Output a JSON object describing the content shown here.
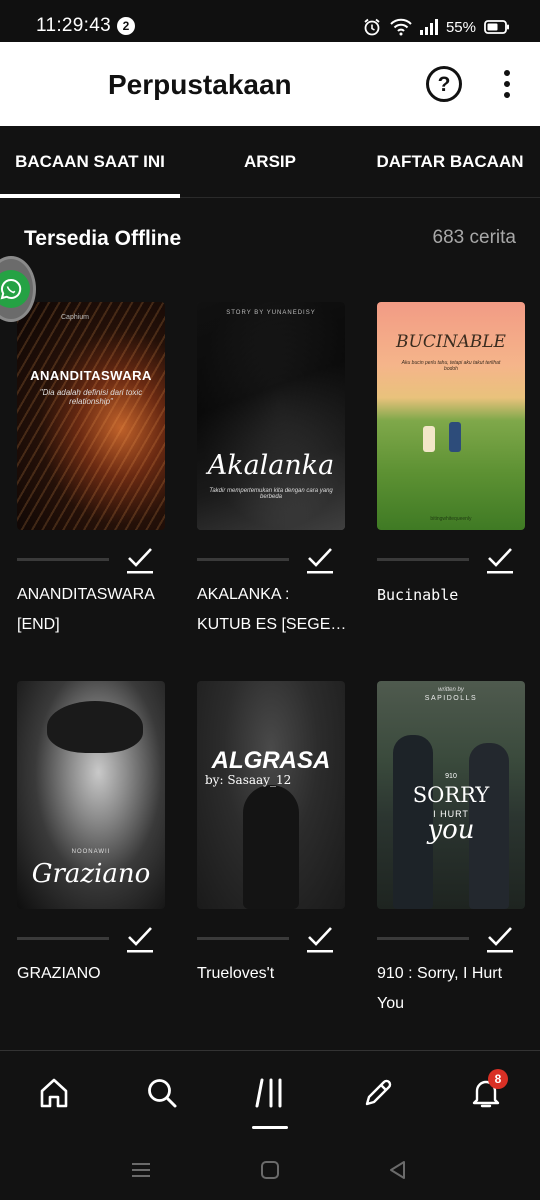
{
  "status_bar": {
    "time": "11:29:43",
    "notification_count": "2",
    "battery": "55%"
  },
  "header": {
    "title": "Perpustakaan",
    "help_icon": "help-circle-icon",
    "more_icon": "more-vertical-icon"
  },
  "tabs": [
    {
      "label": "BACAAN SAAT INI",
      "active": true
    },
    {
      "label": "ARSIP",
      "active": false
    },
    {
      "label": "DAFTAR BACAAN",
      "active": false
    }
  ],
  "section": {
    "title": "Tersedia Offline",
    "count": "683 cerita"
  },
  "stories": [
    {
      "title": "ANANDITASWARA [END]",
      "cover_title": "ANANDITASWARA",
      "cover_sub": "\"Dia adalah definisi dari toxic relationship\"",
      "cover_top": "Caphium",
      "downloaded": true
    },
    {
      "title": "AKALANKA : KUTUB ES [SEGE…",
      "cover_title": "Akalanka",
      "cover_top": "STORY BY YUNANEDISY",
      "cover_sub": "Takdir mempertemukan kita dengan cara yang berbeda",
      "downloaded": true
    },
    {
      "title": "Bucinable",
      "cover_title": "BUCINABLE",
      "cover_sub": "Aku bucin perlu tahu, tetapi aku takut terlihat bodoh",
      "cover_top": "",
      "cover_bottom": "bitingwhitequeenly",
      "downloaded": true
    },
    {
      "title": "GRAZIANO",
      "cover_title": "Graziano",
      "cover_top": "NOONAWII",
      "downloaded": true
    },
    {
      "title": "Trueloves't",
      "cover_title": "ALGRASA",
      "cover_sub": "by: Sasaay_12",
      "downloaded": true
    },
    {
      "title": "910 : Sorry, I Hurt You",
      "cover_title": "SORRY",
      "cover_mid": "I HURT",
      "cover_script": "you",
      "cover_num": "910",
      "cover_top": "written by",
      "cover_author": "SAPIDOLLS",
      "downloaded": true
    }
  ],
  "bottom_nav": {
    "items": [
      "home-icon",
      "search-icon",
      "library-icon",
      "write-icon",
      "notifications-icon"
    ],
    "active": "library-icon",
    "notification_badge": "8"
  },
  "colors": {
    "background": "#121212",
    "header": "#ffffff",
    "badge": "#d93025",
    "floating_bubble": "#25a244"
  }
}
